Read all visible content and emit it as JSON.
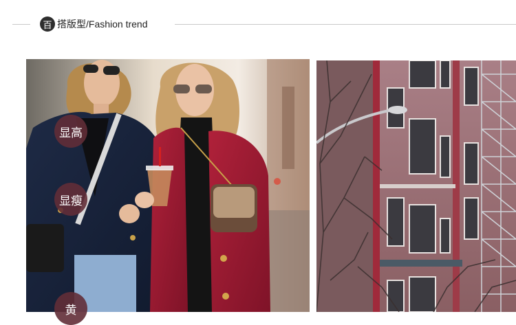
{
  "header": {
    "badge": "百",
    "title": "搭版型",
    "subtitle": "/Fashion trend"
  },
  "photos": {
    "left_icon": "street-fashion-photo",
    "right_icon": "brick-building-photo"
  },
  "tags": [
    {
      "label": "显高"
    },
    {
      "label": "显瘦"
    },
    {
      "label": "黄"
    }
  ]
}
